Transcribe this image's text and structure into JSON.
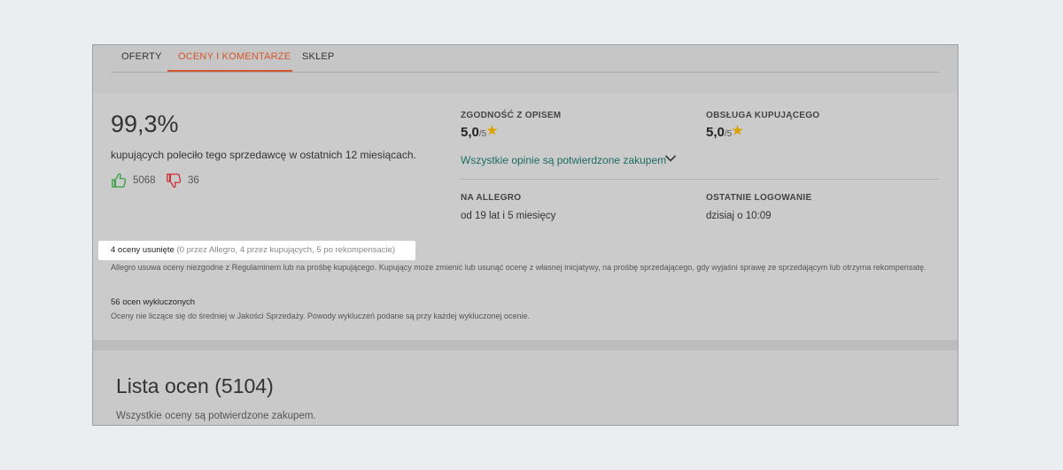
{
  "tabs": [
    {
      "label": "OFERTY"
    },
    {
      "label": "OCENY I KOMENTARZE"
    },
    {
      "label": "SKLEP"
    }
  ],
  "summary": {
    "percent": "99,3%",
    "description": "kupujących poleciło tego sprzedawcę w ostatnich 12 miesiącach.",
    "positive_count": "5068",
    "negative_count": "36"
  },
  "ratings": {
    "description_match": {
      "label": "ZGODNOŚĆ Z OPISEM",
      "value": "5,0",
      "of": "/5"
    },
    "buyer_service": {
      "label": "OBSŁUGA KUPUJĄCEGO",
      "value": "5,0",
      "of": "/5"
    },
    "verified_link": "Wszystkie opinie są potwierdzone zakupem"
  },
  "info": {
    "on_allegro_label": "NA ALLEGRO",
    "on_allegro_value": "od 19 lat i 5 miesięcy",
    "last_login_label": "OSTATNIE LOGOWANIE",
    "last_login_value": "dzisiaj o 10:09"
  },
  "removed": {
    "main": "4 oceny usunięte",
    "detail": " (0 przez Allegro, 4 przez kupujących, 5 po rekompensacie)",
    "note": "Allegro usuwa oceny niezgodne z Regulaminem lub na prośbę kupującego. Kupujący może zmienić lub usunąć ocenę z własnej inicjatywy, na prośbę sprzedającego, gdy wyjaśni sprawę ze sprzedającym lub otrzyma rekompensatę."
  },
  "excluded": {
    "main": "56 ocen wykluczonych",
    "note": "Oceny nie liczące się do średniej w Jakości Sprzedaży. Powody wykluczeń podane są przy każdej wykluczonej ocenie."
  },
  "list": {
    "title": "Lista ocen (5104)",
    "subtitle": "Wszystkie oceny są potwierdzone zakupem."
  },
  "colors": {
    "accent": "#d4572b",
    "link": "#1d6c61",
    "star": "#d8a300",
    "thumb_up": "#3aa142",
    "thumb_down": "#c9353a"
  }
}
